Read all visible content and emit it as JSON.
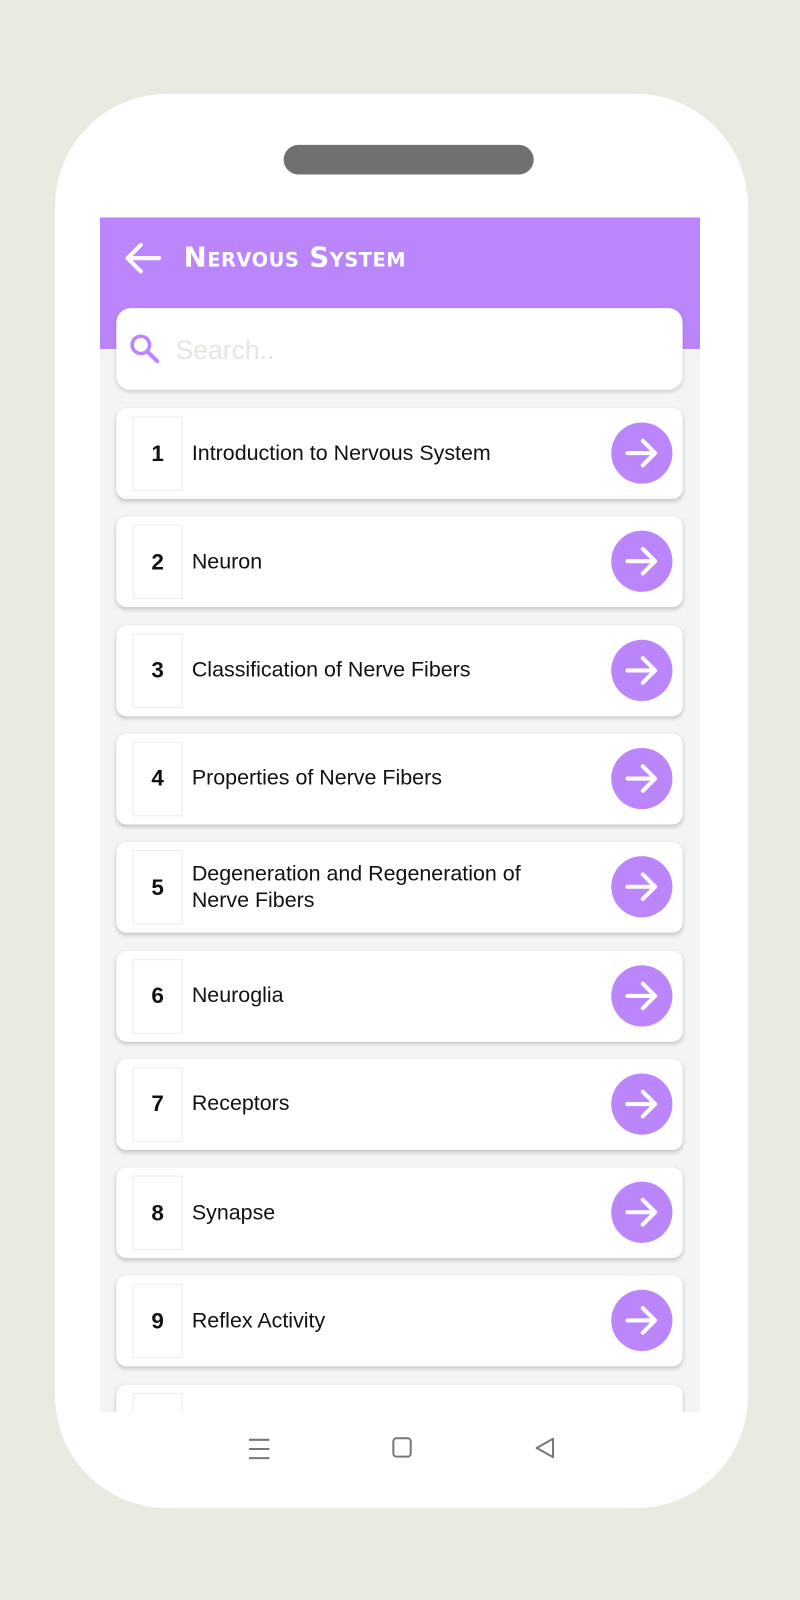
{
  "app": {
    "title": "Nervous System",
    "accent_color": "#bb86fc"
  },
  "search": {
    "placeholder": "Search..",
    "value": ""
  },
  "chapters": [
    {
      "number": "1",
      "title": "Introduction to Nervous System"
    },
    {
      "number": "2",
      "title": "Neuron"
    },
    {
      "number": "3",
      "title": "Classification of Nerve Fibers"
    },
    {
      "number": "4",
      "title": "Properties of Nerve Fibers"
    },
    {
      "number": "5",
      "title": "Degeneration and Regeneration of Nerve Fibers"
    },
    {
      "number": "6",
      "title": "Neuroglia"
    },
    {
      "number": "7",
      "title": "Receptors"
    },
    {
      "number": "8",
      "title": "Synapse"
    },
    {
      "number": "9",
      "title": "Reflex Activity"
    }
  ],
  "icons": {
    "back": "arrow-left-icon",
    "search": "search-icon",
    "open": "arrow-right-icon",
    "nav": [
      "menu-icon",
      "home-square-icon",
      "back-triangle-icon"
    ]
  }
}
